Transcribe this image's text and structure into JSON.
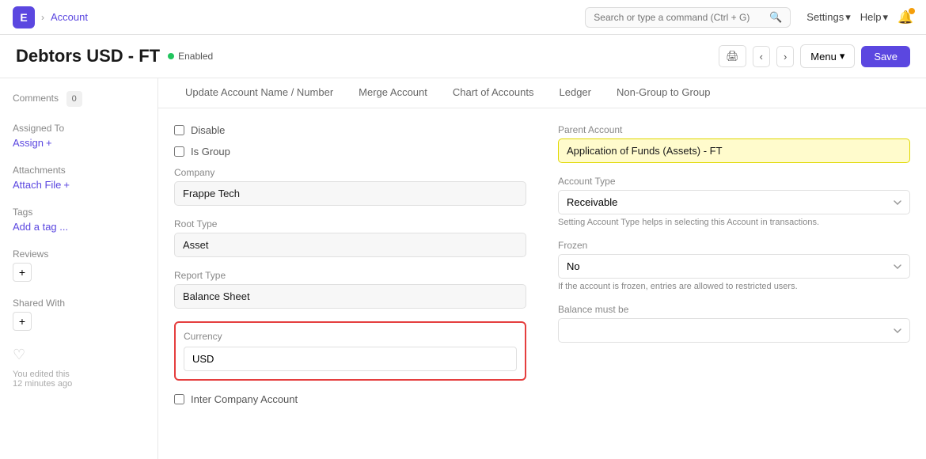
{
  "app": {
    "icon_label": "E",
    "breadcrumb": "Account",
    "search_placeholder": "Search or type a command (Ctrl + G)",
    "settings_label": "Settings",
    "help_label": "Help"
  },
  "page": {
    "title": "Debtors USD - FT",
    "status": "Enabled",
    "btn_menu": "Menu",
    "btn_save": "Save"
  },
  "tabs": [
    {
      "label": "Update Account Name / Number"
    },
    {
      "label": "Merge Account"
    },
    {
      "label": "Chart of Accounts"
    },
    {
      "label": "Ledger"
    },
    {
      "label": "Non-Group to Group"
    }
  ],
  "sidebar": {
    "comments_label": "Comments",
    "comments_count": "0",
    "assigned_to_label": "Assigned To",
    "assign_label": "Assign",
    "assign_plus": "+",
    "attachments_label": "Attachments",
    "attach_file_label": "Attach File",
    "attach_plus": "+",
    "tags_label": "Tags",
    "add_tag_label": "Add a tag ...",
    "reviews_label": "Reviews",
    "reviews_add": "+",
    "shared_with_label": "Shared With",
    "shared_add": "+",
    "edit_note": "You edited this",
    "edit_time": "12 minutes ago"
  },
  "form": {
    "disable_label": "Disable",
    "is_group_label": "Is Group",
    "company_label": "Company",
    "company_value": "Frappe Tech",
    "root_type_label": "Root Type",
    "root_type_value": "Asset",
    "report_type_label": "Report Type",
    "report_type_value": "Balance Sheet",
    "currency_label": "Currency",
    "currency_value": "USD",
    "inter_company_label": "Inter Company Account",
    "parent_account_label": "Parent Account",
    "parent_account_value": "Application of Funds (Assets) - FT",
    "account_type_label": "Account Type",
    "account_type_value": "Receivable",
    "account_type_hint": "Setting Account Type helps in selecting this Account in transactions.",
    "frozen_label": "Frozen",
    "frozen_value": "No",
    "frozen_hint": "If the account is frozen, entries are allowed to restricted users.",
    "balance_must_be_label": "Balance must be"
  }
}
